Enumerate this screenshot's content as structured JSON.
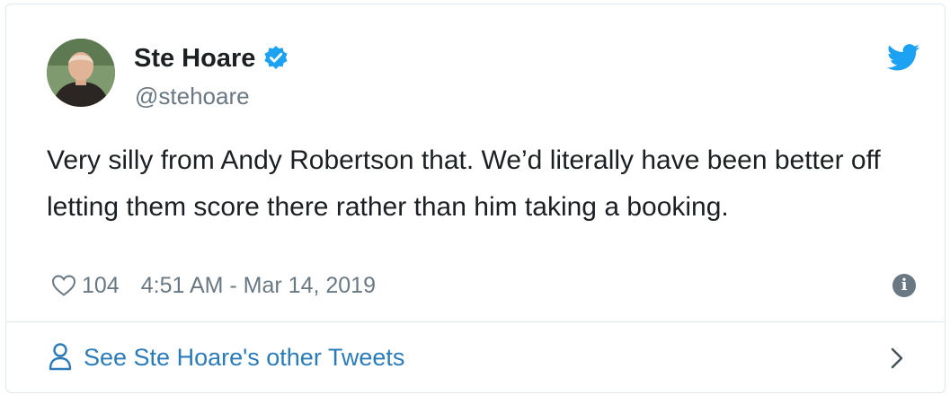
{
  "user": {
    "display_name": "Ste Hoare",
    "handle": "@stehoare",
    "verified": true
  },
  "tweet": {
    "text": "Very silly from Andy Robertson that. We’d literally have been better off letting them score there rather than him taking a booking.",
    "like_count": "104",
    "timestamp": "4:51 AM - Mar 14, 2019"
  },
  "footer": {
    "link_text": "See Ste Hoare's other Tweets"
  },
  "icons": {
    "brand": "twitter-bird-icon",
    "like": "heart-icon",
    "info": "info-icon",
    "profile": "person-icon",
    "more": "chevron-right-icon"
  },
  "colors": {
    "twitter_blue": "#1da1f2",
    "link": "#2b7bb9",
    "muted": "#697882",
    "text": "#1c2022",
    "border": "#e1e8ed"
  }
}
